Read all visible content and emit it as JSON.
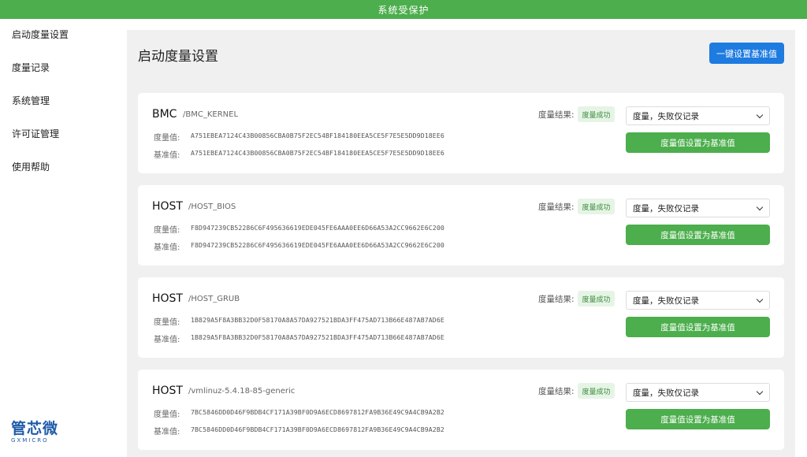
{
  "topbar": {
    "title": "系统受保护"
  },
  "sidebar": {
    "items": [
      {
        "label": "启动度量设置"
      },
      {
        "label": "度量记录"
      },
      {
        "label": "系统管理"
      },
      {
        "label": "许可证管理"
      },
      {
        "label": "使用帮助"
      }
    ]
  },
  "logo": {
    "main": "芯微",
    "prefix": "管",
    "sub": "GXMICRO"
  },
  "main": {
    "title": "启动度量设置",
    "baseline_all_button": "一键设置基准值",
    "labels": {
      "measure": "度量值:",
      "baseline": "基准值:",
      "result": "度量结果:"
    },
    "cards": [
      {
        "type": "BMC",
        "path": "/BMC_KERNEL",
        "measure_value": "A751EBEA7124C43B00856CBA0B75F2EC54BF184180EEA5CE5F7E5E5DD9D18EE6",
        "baseline_value": "A751EBEA7124C43B00856CBA0B75F2EC54BF184180EEA5CE5F7E5E5DD9D18EE6",
        "result": "度量成功",
        "select_value": "度量，失败仅记录",
        "set_button": "度量值设置为基准值"
      },
      {
        "type": "HOST",
        "path": "/HOST_BIOS",
        "measure_value": "F8D947239CB52286C6F495636619EDE045FE6AAA0EE6D66A53A2CC9662E6C200",
        "baseline_value": "F8D947239CB52286C6F495636619EDE045FE6AAA0EE6D66A53A2CC9662E6C200",
        "result": "度量成功",
        "select_value": "度量，失败仅记录",
        "set_button": "度量值设置为基准值"
      },
      {
        "type": "HOST",
        "path": "/HOST_GRUB",
        "measure_value": "1B829A5F8A3BB32D0F58170A8A57DA927521BDA3FF475AD713B66E487AB7AD6E",
        "baseline_value": "1B829A5F8A3BB32D0F58170A8A57DA927521BDA3FF475AD713B66E487AB7AD6E",
        "result": "度量成功",
        "select_value": "度量，失败仅记录",
        "set_button": "度量值设置为基准值"
      },
      {
        "type": "HOST",
        "path": "/vmlinuz-5.4.18-85-generic",
        "measure_value": "7BC5846DD0D46F9BDB4CF171A39BF0D9A6ECD8697812FA9B36E49C9A4CB9A2B2",
        "baseline_value": "7BC5846DD0D46F9BDB4CF171A39BF0D9A6ECD8697812FA9B36E49C9A4CB9A2B2",
        "result": "度量成功",
        "select_value": "度量，失败仅记录",
        "set_button": "度量值设置为基准值"
      }
    ]
  }
}
